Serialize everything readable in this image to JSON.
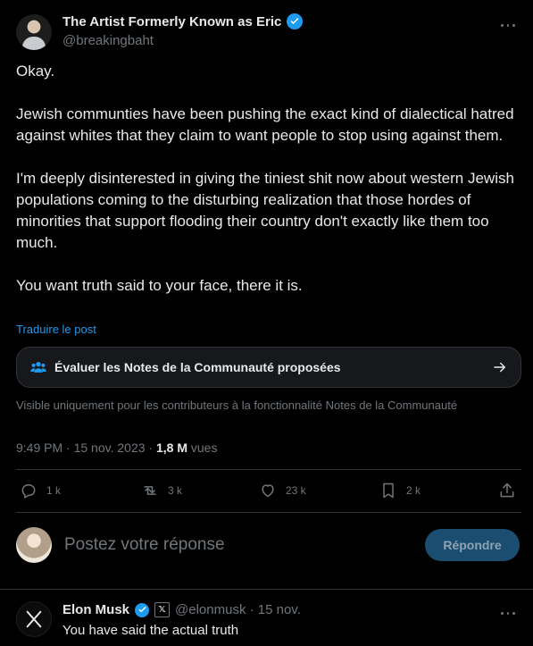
{
  "tweet": {
    "display_name": "The Artist Formerly Known as Eric",
    "handle": "@breakingbaht",
    "paragraphs": [
      "Okay.",
      "Jewish communties have been pushing the exact kind of dialectical hatred against whites that they claim to want people to stop using against them.",
      "I'm deeply disinterested in giving the tiniest shit now about western Jewish populations coming to the disturbing realization that those hordes of minorities that support flooding their country don't exactly like them too much.",
      "You want truth said to your face, there it is."
    ],
    "translate_label": "Traduire le post",
    "community_notes": {
      "label": "Évaluer les Notes de la Communauté proposées",
      "visibility_note": "Visible uniquement pour les contributeurs à la fonctionnalité Notes de la Communauté"
    },
    "meta": {
      "time": "9:49 PM",
      "date": "15 nov. 2023",
      "separator": "·",
      "views_count": "1,8 M",
      "views_label": "vues"
    },
    "actions": {
      "replies": "1 k",
      "reposts": "3 k",
      "likes": "23 k",
      "bookmarks": "2 k"
    }
  },
  "composer": {
    "placeholder": "Postez votre réponse",
    "button_label": "Répondre"
  },
  "reply": {
    "display_name": "Elon Musk",
    "badge": "𝕏",
    "handle_and_date": "@elonmusk · 15 nov.",
    "text": "You have said the actual truth"
  },
  "colors": {
    "background": "#000000",
    "text": "#e7e9ea",
    "muted": "#71767b",
    "accent": "#1d9bf0",
    "divider": "#2f3336"
  },
  "icons": [
    "verified-icon",
    "more-icon",
    "people-icon",
    "arrow-right-icon",
    "reply-icon",
    "repost-icon",
    "like-icon",
    "bookmark-icon",
    "share-icon",
    "x-logo-icon"
  ]
}
